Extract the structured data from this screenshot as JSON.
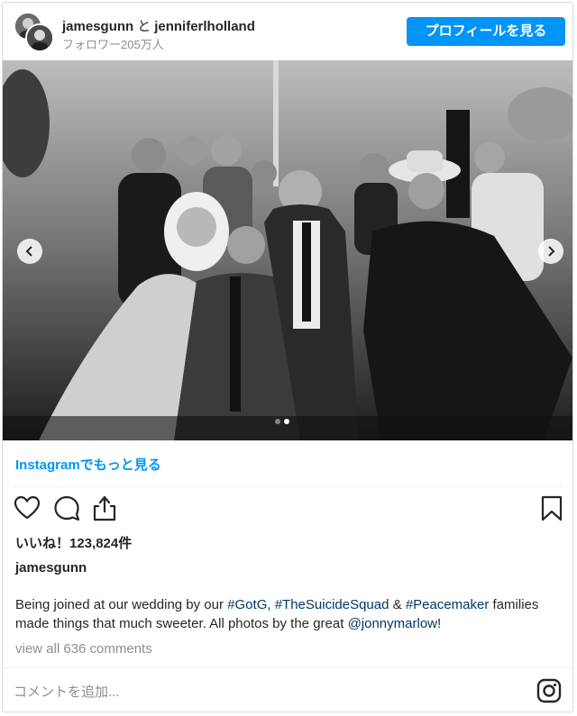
{
  "header": {
    "account_primary": "jamesgunn",
    "separator": "と",
    "account_secondary": "jenniferlholland",
    "followers": "フォロワー205万人",
    "profile_button": "プロフィールを見る"
  },
  "carousel": {
    "dot_count": 2,
    "active_dot": 1
  },
  "view_more_link": "Instagramでもっと見る",
  "likes": "いいね！123,824件",
  "post_username": "jamesgunn",
  "caption": {
    "part1": "Being joined at our wedding by our ",
    "tag1": "#GotG",
    "part2": ", ",
    "tag2": "#TheSuicideSquad",
    "part3": " & ",
    "tag3": "#Peacemaker",
    "part4": " families made things that much sweeter. All photos by the great ",
    "mention": "@jonnymarlow",
    "part5": "!"
  },
  "view_comments": "view all 636 comments",
  "comment_placeholder": "コメントを追加...",
  "colors": {
    "accent": "#0095f6",
    "link_dark": "#00376b",
    "muted": "#8e8e8e"
  },
  "icons": [
    "heart-icon",
    "comment-icon",
    "share-icon",
    "bookmark-icon",
    "instagram-icon",
    "chevron-left-icon",
    "chevron-right-icon"
  ]
}
